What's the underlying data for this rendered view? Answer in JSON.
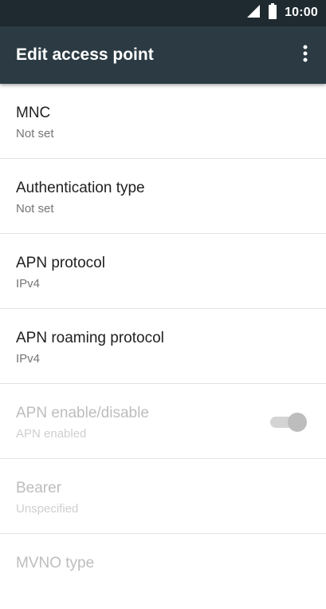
{
  "status_bar": {
    "time": "10:00",
    "icons": [
      "signal-icon",
      "battery-icon"
    ]
  },
  "app_bar": {
    "title": "Edit access point",
    "overflow_icon": "more-vert-icon"
  },
  "colors": {
    "status_bar": "#1f2a30",
    "app_bar": "#2c3b43",
    "title_text": "#212121",
    "summary_text": "#757575",
    "disabled_text": "#bdbdbd"
  },
  "preferences": [
    {
      "title": "MNC",
      "summary": "Not set",
      "enabled": true
    },
    {
      "title": "Authentication type",
      "summary": "Not set",
      "enabled": true
    },
    {
      "title": "APN protocol",
      "summary": "IPv4",
      "enabled": true
    },
    {
      "title": "APN roaming protocol",
      "summary": "IPv4",
      "enabled": true
    },
    {
      "title": "APN enable/disable",
      "summary": "APN enabled",
      "enabled": false,
      "switch_on": true
    },
    {
      "title": "Bearer",
      "summary": "Unspecified",
      "enabled": false
    },
    {
      "title": "MVNO type",
      "summary": "",
      "enabled": false
    }
  ]
}
